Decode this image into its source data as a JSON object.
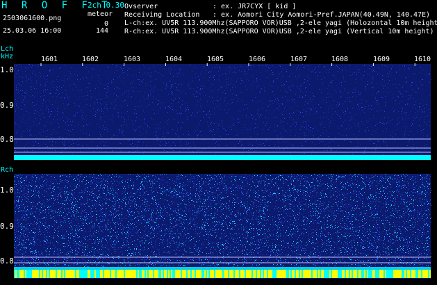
{
  "header": {
    "app_title": "H R O F F T",
    "mode": "2ch 0.30",
    "filename": "2503061600.png",
    "datetime": "25.03.06 16:00",
    "meteor_label": "meteor",
    "meteor_count_l": "0",
    "meteor_count_r": "144",
    "observer_label": "Ovserver",
    "observer_value": ": ex. JR7CYX [ kid ]",
    "location_label": "Receiving Location",
    "location_value": ": ex. Aomori City Aomori-Pref.JAPAN(40.49N, 140.47E)",
    "lch_line": "L-ch:ex. UV5R 113.900Mhz(SAPPORO VOR)USB ,2-ele yagi (Holozontal 10m height",
    "rch_line": "R-ch:ex. UV5R 113.900Mhz(SAPPORO VOR)USB ,2-ele yagi (Vertical 10m height)"
  },
  "lch_panel": {
    "label": "Lch",
    "unit": "kHz",
    "yticks": [
      "1.0",
      "0.9",
      "0.8"
    ]
  },
  "rch_panel": {
    "label": "Rch",
    "yticks": [
      "1.0",
      "0.9",
      "0.8"
    ]
  },
  "time_ticks": [
    "1601",
    "1602",
    "1603",
    "1604",
    "1605",
    "1606",
    "1607",
    "1608",
    "1609",
    "1610"
  ],
  "colors": {
    "background": "#000000",
    "spectrum_bg": "#0c1a6e",
    "noise_low": "#1a3cd0",
    "noise_high": "#00e0ff",
    "baseline": "#00ffff",
    "marker": "#ffff00",
    "text": "#ffffff",
    "title": "#00ffff"
  }
}
